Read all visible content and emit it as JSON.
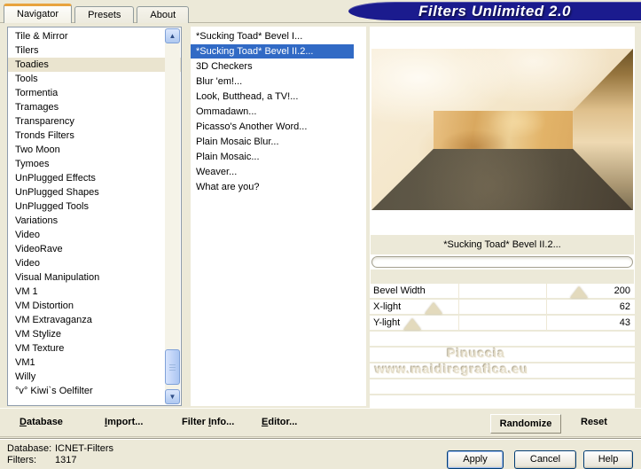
{
  "window": {
    "title": "Filters Unlimited 2.0"
  },
  "colors": {
    "accent": "#316ac5",
    "banner": "#1b1b8e",
    "tab_accent": "#e8a33d"
  },
  "tabs": [
    {
      "label": "Navigator",
      "active": true
    },
    {
      "label": "Presets",
      "active": false
    },
    {
      "label": "About",
      "active": false
    }
  ],
  "categories": {
    "selected_index": 2,
    "items": [
      "Tile & Mirror",
      "Tilers",
      "Toadies",
      "Tools",
      "Tormentia",
      "Tramages",
      "Transparency",
      "Tronds Filters",
      "Two Moon",
      "Tymoes",
      "UnPlugged Effects",
      "UnPlugged Shapes",
      "UnPlugged Tools",
      "Variations",
      "Video",
      "VideoRave",
      "Video",
      "Visual Manipulation",
      "VM 1",
      "VM Distortion",
      "VM Extravaganza",
      "VM Stylize",
      "VM Texture",
      "VM1",
      "Willy",
      "°v° Kiwi`s Oelfilter"
    ]
  },
  "filters_list": {
    "selected_index": 1,
    "items": [
      "*Sucking Toad*  Bevel I...",
      "*Sucking Toad*  Bevel II.2...",
      "3D Checkers",
      "Blur 'em!...",
      "Look, Butthead, a TV!...",
      "Ommadawn...",
      "Picasso's Another Word...",
      "Plain Mosaic Blur...",
      "Plain Mosaic...",
      "Weaver...",
      "What are you?"
    ]
  },
  "preview": {
    "filter_label": "*Sucking Toad*  Bevel II.2..."
  },
  "sliders": [
    {
      "label": "Bevel Width",
      "value": "200",
      "pct": 79
    },
    {
      "label": "X-light",
      "value": "62",
      "pct": 24
    },
    {
      "label": "Y-light",
      "value": "43",
      "pct": 16
    }
  ],
  "watermark": {
    "line1": "Pinuccia",
    "line2": "www.maidiregrafica.eu"
  },
  "actions": {
    "database": {
      "hot": "D",
      "rest": "atabase"
    },
    "import": {
      "hot": "I",
      "rest": "mport..."
    },
    "filter_info": {
      "pre": "Filter ",
      "hot": "I",
      "rest": "nfo..."
    },
    "editor": {
      "hot": "E",
      "rest": "ditor..."
    },
    "randomize": "Randomize",
    "reset": "Reset"
  },
  "status": {
    "database_label": "Database:",
    "database_value": "ICNET-Filters",
    "filters_label": "Filters:",
    "filters_value": "1317"
  },
  "footer_buttons": {
    "apply": "Apply",
    "cancel": "Cancel",
    "help": "Help"
  }
}
